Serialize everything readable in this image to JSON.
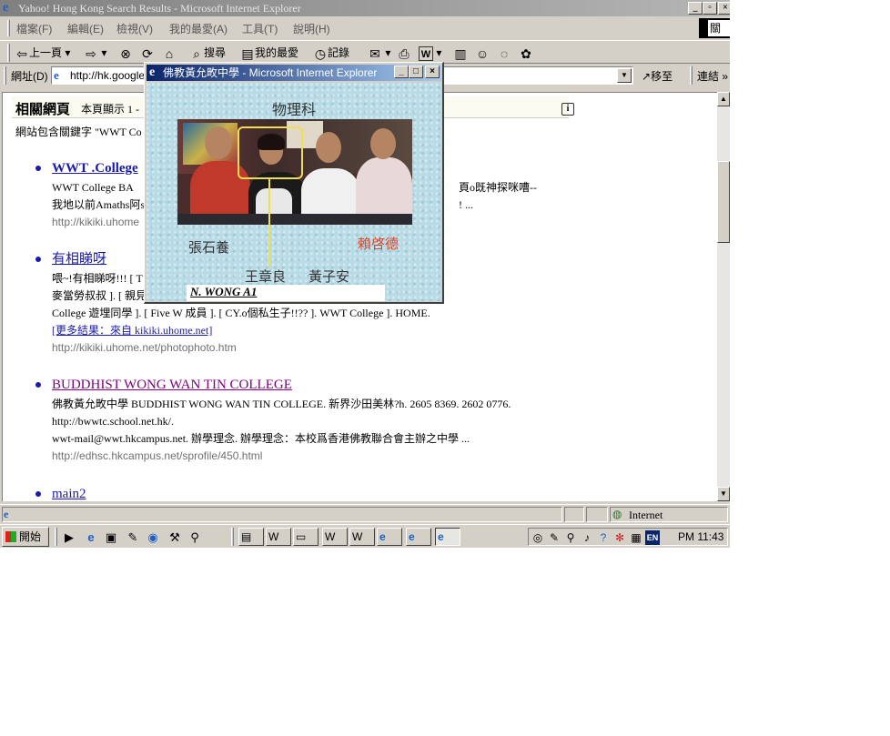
{
  "window": {
    "title": "Yahoo! Hong Kong Search Results - Microsoft Internet Explorer",
    "right_edge_label": "關閉"
  },
  "menu": [
    "檔案(F)",
    "編輯(E)",
    "檢視(V)",
    "我的最愛(A)",
    "工具(T)",
    "說明(H)"
  ],
  "toolbar": {
    "back": "上一頁",
    "search": "搜尋",
    "favorites": "我的最愛",
    "history": "記錄"
  },
  "address": {
    "label": "網址(D)",
    "value": "http://hk.google.",
    "go": "移至",
    "links": "連結"
  },
  "results_header": {
    "title": "相關網頁",
    "subtitle": "本頁顯示 1 -"
  },
  "keyword_line": "網站包含關鍵字 \"WWT Co",
  "results": [
    {
      "title": "WWT .College",
      "lines": [
        "WWT College BA",
        "我地以前Amaths阿s"
      ],
      "lines_tail": [
        "頁o既神探咪嘈--",
        "! ..."
      ],
      "url": "http://kikiki.uhome"
    },
    {
      "title": "有相睇呀",
      "lines": [
        "喂~!有相睇呀!!! [ T",
        "麥當勞叔叔 ]. [ 親見"
      ],
      "line3": "College 遊埋同學 ]. [ Five W 成員 ]. [ CY.o個私生子!!?? ]. WWT College ]. HOME.",
      "more": "[更多結果：來自 kikiki.uhome.net]",
      "url": "http://kikiki.uhome.net/photophoto.htm"
    },
    {
      "title": "BUDDHIST WONG WAN TIN COLLEGE",
      "lines": [
        "佛教黃允畋中學 BUDDHIST WONG WAN TIN COLLEGE. 新界沙田美林?h. 2605 8369. 2602 0776.",
        "http://bwwtc.school.net.hk/.",
        "wwt-mail@wwt.hkcampus.net. 辦學理念. 辦學理念：本校爲香港佛教聯合會主辦之中學 ..."
      ],
      "url": "http://edhsc.hkcampus.net/sprofile/450.html"
    },
    {
      "title": "main2"
    }
  ],
  "status": {
    "zone": "Internet"
  },
  "taskbar": {
    "start": "開始",
    "clock": "PM 11:43",
    "lang": "EN"
  },
  "popup": {
    "title": "佛教黃允畋中學 - Microsoft Internet Explorer",
    "heading": "物理科",
    "names": {
      "left": "張石養",
      "right": "賴啓德",
      "center": "王章良",
      "center_right": "黃子安"
    },
    "signature": "N. WONG A1"
  },
  "colors": {
    "accent_title": "#0a246a",
    "link": "#1a1ab0",
    "visited": "#800080",
    "highlight": "#f0e050",
    "name_red": "#d6452a"
  }
}
